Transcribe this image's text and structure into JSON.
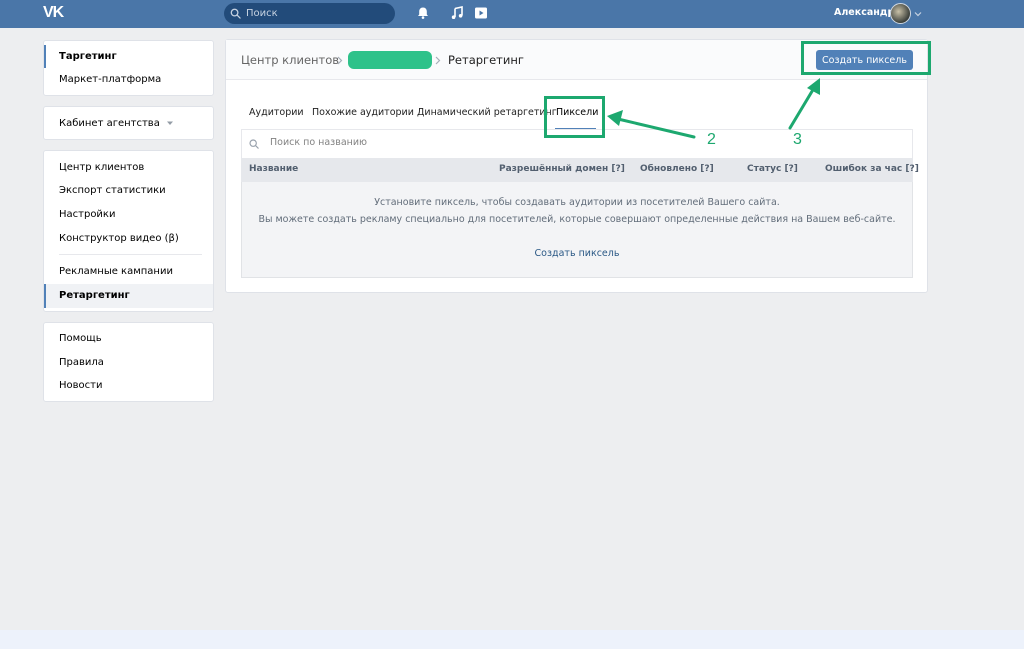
{
  "topbar": {
    "logo": "VK",
    "search_placeholder": "Поиск",
    "user_name": "Александр"
  },
  "sidebar": {
    "panel1": [
      {
        "label": "Таргетинг",
        "active": true
      },
      {
        "label": "Маркет-платформа",
        "active": false
      }
    ],
    "agency": {
      "label": "Кабинет агентства"
    },
    "panel3_group1": [
      {
        "label": "Центр клиентов"
      },
      {
        "label": "Экспорт статистики"
      },
      {
        "label": "Настройки"
      },
      {
        "label": "Конструктор видео (β)"
      }
    ],
    "panel3_group2": [
      {
        "label": "Рекламные кампании",
        "active": false
      },
      {
        "label": "Ретаргетинг",
        "active": true
      }
    ],
    "panel4": [
      {
        "label": "Помощь"
      },
      {
        "label": "Правила"
      },
      {
        "label": "Новости"
      }
    ]
  },
  "main": {
    "breadcrumb": {
      "root": "Центр клиентов",
      "current": "Ретаргетинг"
    },
    "create_button": "Создать пиксель",
    "tabs": [
      {
        "label": "Аудитории",
        "active": false
      },
      {
        "label": "Похожие аудитории",
        "active": false
      },
      {
        "label": "Динамический ретаргетинг",
        "active": false
      },
      {
        "label": "Пиксели",
        "active": true
      }
    ],
    "table": {
      "search_placeholder": "Поиск по названию",
      "columns": [
        "Название",
        "Разрешённый домен [?]",
        "Обновлено [?]",
        "Статус [?]",
        "Ошибок за час [?]"
      ],
      "empty_line1": "Установите пиксель, чтобы создавать аудитории из посетителей Вашего сайта.",
      "empty_line2": "Вы можете создать рекламу специально для посетителей, которые совершают определенные действия на Вашем веб-сайте.",
      "empty_link": "Создать пиксель"
    }
  },
  "annotations": {
    "label2": "2",
    "label3": "3",
    "color": "#1da86f"
  },
  "colors": {
    "topbar": "#4a76a8",
    "accent": "#5181b8",
    "background": "#edeef0"
  }
}
